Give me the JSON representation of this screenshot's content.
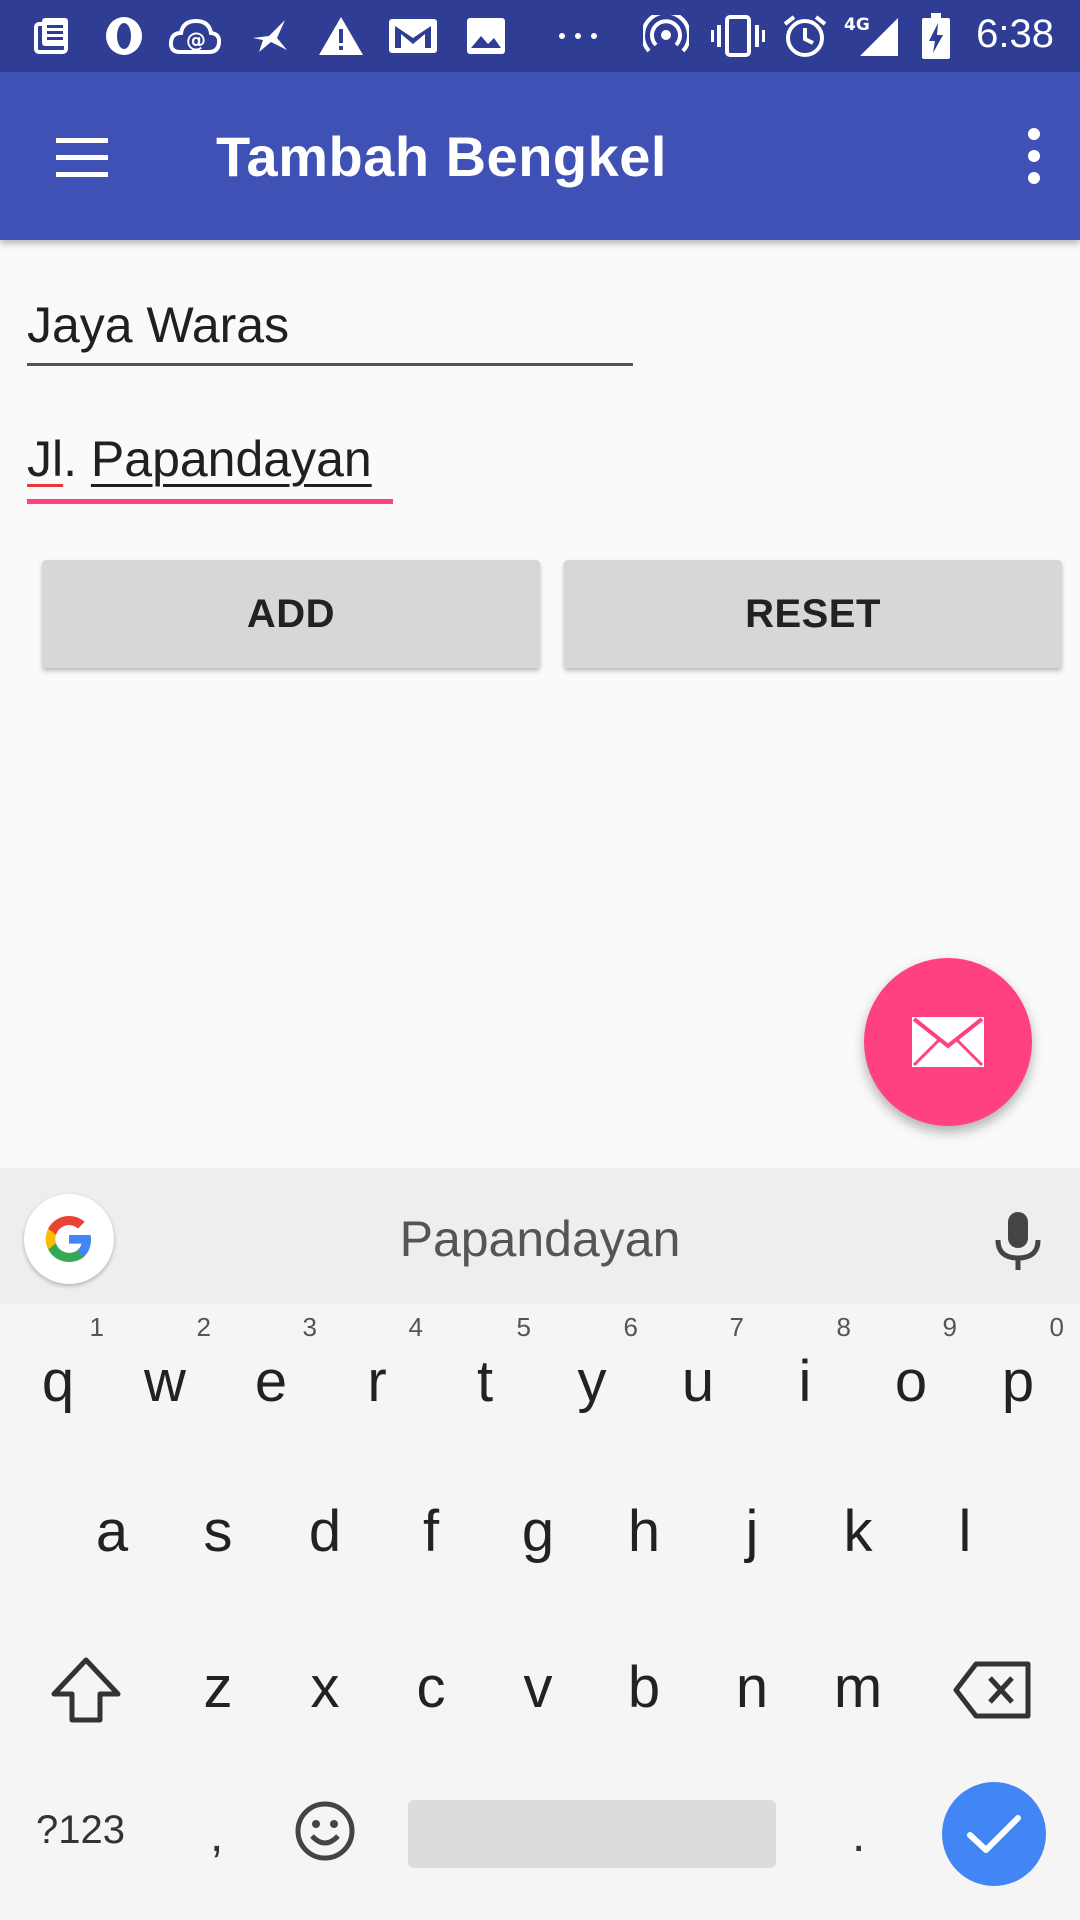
{
  "status_bar": {
    "time": "6:38",
    "network_label": "4G",
    "icons": [
      "news-icon",
      "opera-icon",
      "cloud-icon",
      "bird-icon",
      "warning-icon",
      "mail-icon",
      "image-icon",
      "more-dots-icon",
      "hotspot-icon",
      "vibrate-icon",
      "alarm-icon",
      "signal-icon",
      "battery-charging-icon"
    ]
  },
  "toolbar": {
    "title": "Tambah Bengkel",
    "color": "#3f51b5"
  },
  "form": {
    "name_value": "Jaya Waras",
    "address_value": "Jl. Papandayan",
    "address_prefix": "Jl",
    "address_rest": "Papandayan"
  },
  "buttons": {
    "add_label": "ADD",
    "reset_label": "RESET"
  },
  "fab": {
    "icon": "mail-icon",
    "color": "#ff4081"
  },
  "keyboard": {
    "suggestion": "Papandayan",
    "row1": [
      {
        "key": "q",
        "hint": "1"
      },
      {
        "key": "w",
        "hint": "2"
      },
      {
        "key": "e",
        "hint": "3"
      },
      {
        "key": "r",
        "hint": "4"
      },
      {
        "key": "t",
        "hint": "5"
      },
      {
        "key": "y",
        "hint": "6"
      },
      {
        "key": "u",
        "hint": "7"
      },
      {
        "key": "i",
        "hint": "8"
      },
      {
        "key": "o",
        "hint": "9"
      },
      {
        "key": "p",
        "hint": "0"
      }
    ],
    "row2": [
      "a",
      "s",
      "d",
      "f",
      "g",
      "h",
      "j",
      "k",
      "l"
    ],
    "row3": [
      "z",
      "x",
      "c",
      "v",
      "b",
      "n",
      "m"
    ],
    "symbols_label": "?123",
    "comma_label": ",",
    "period_label": ".",
    "enter_color": "#4285f4"
  }
}
